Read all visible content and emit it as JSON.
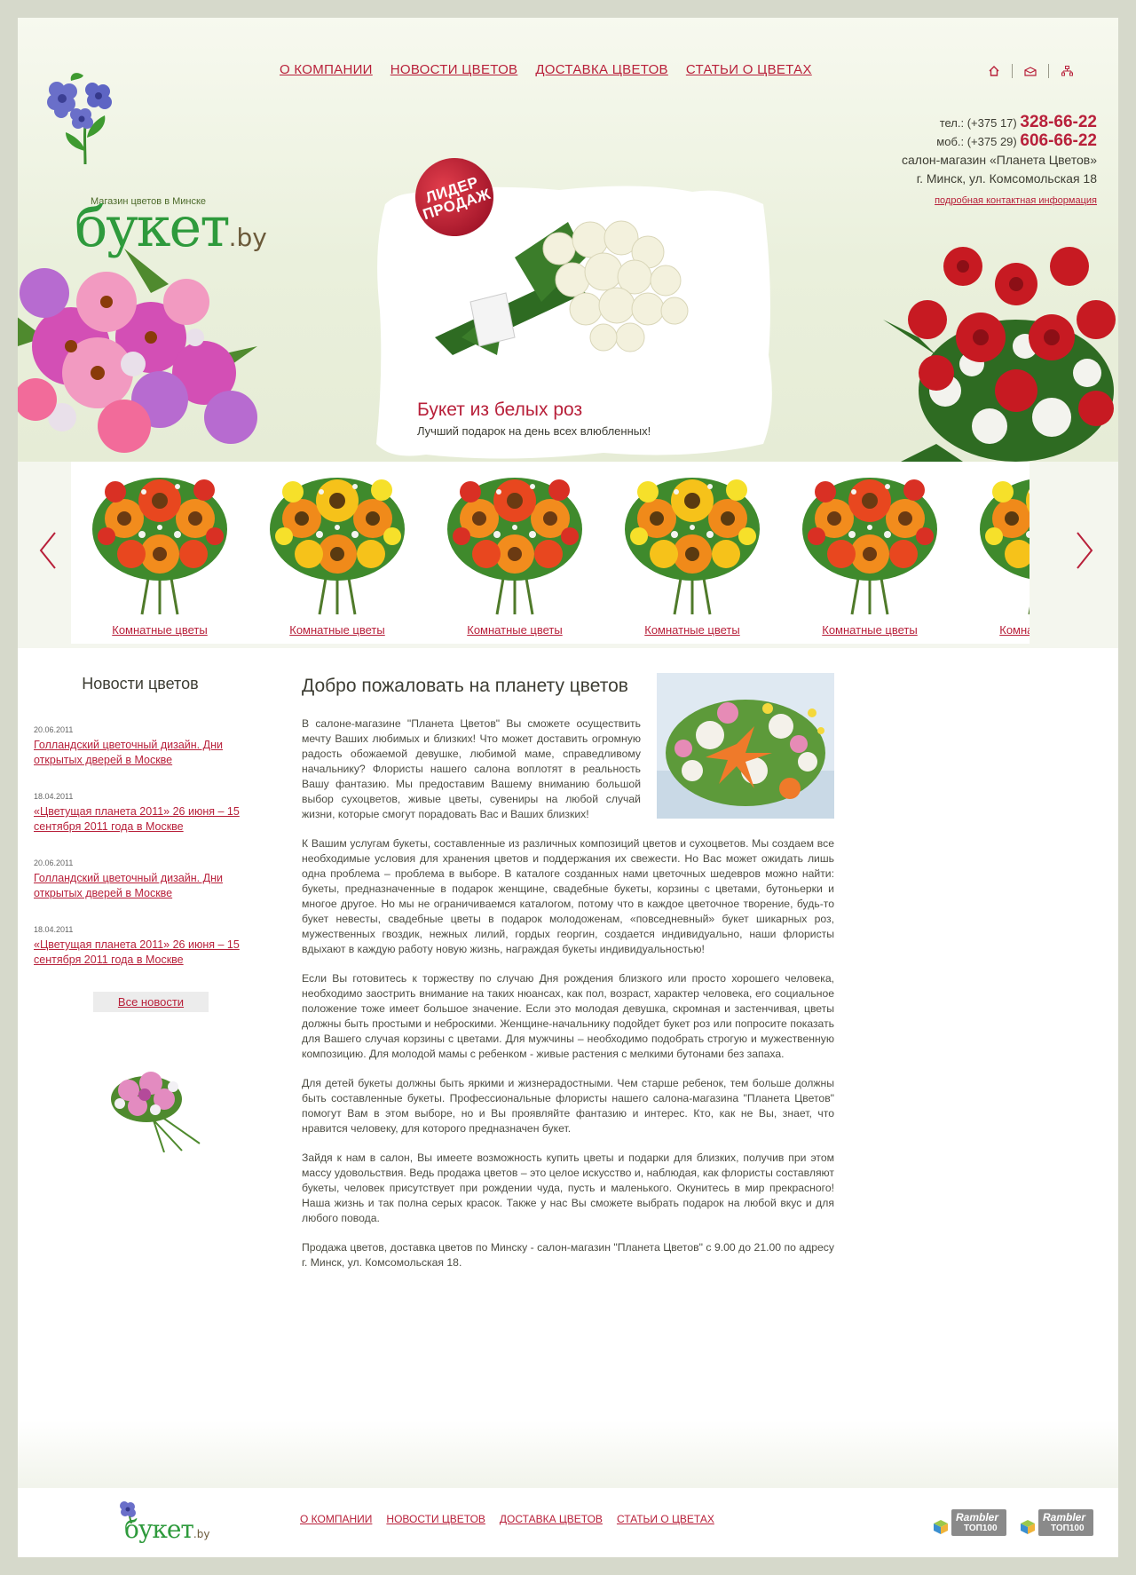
{
  "header": {
    "logo_tagline": "Магазин цветов в Минске",
    "logo_main": "букет",
    "logo_suffix": ".by",
    "nav": [
      "О КОМПАНИИ",
      "НОВОСТИ ЦВЕТОВ",
      "ДОСТАВКА ЦВЕТОВ",
      "СТАТЬИ О ЦВЕТАХ"
    ],
    "icons": [
      "home-icon",
      "mail-icon",
      "sitemap-icon"
    ],
    "contacts": {
      "tel_label": "тел.: (+375 17)",
      "tel_number": "328-66-22",
      "mob_label": "моб.: (+375 29)",
      "mob_number": "606-66-22",
      "salon": "салон-магазин «Планета Цветов»",
      "address": "г. Минск, ул. Комсомольская 18",
      "details_link": "подробная контактная информация"
    }
  },
  "promo": {
    "badge_line1": "ЛИДЕР",
    "badge_line2": "ПРОДАЖ",
    "title": "Букет из белых роз",
    "subtitle": "Лучший подарок на день всех влюбленных!"
  },
  "carousel": {
    "items": [
      {
        "caption": "Комнатные цветы"
      },
      {
        "caption": "Комнатные цветы"
      },
      {
        "caption": "Комнатные цветы"
      },
      {
        "caption": "Комнатные цветы"
      },
      {
        "caption": "Комнатные цветы"
      },
      {
        "caption": "Комнатные цветы"
      }
    ]
  },
  "sidebar": {
    "title": "Новости цветов",
    "news": [
      {
        "date": "20.06.2011",
        "title": "Голландский цветочный дизайн. Дни открытых дверей в Москве"
      },
      {
        "date": "18.04.2011",
        "title": "«Цветущая планета 2011» 26 июня – 15 сентября 2011 года в Москве"
      },
      {
        "date": "20.06.2011",
        "title": "Голландский цветочный дизайн. Дни открытых дверей в Москве"
      },
      {
        "date": "18.04.2011",
        "title": "«Цветущая планета 2011» 26 июня – 15 сентября 2011 года в Москве"
      }
    ],
    "all_news": "Все новости"
  },
  "main": {
    "title": "Добро пожаловать на планету цветов",
    "paragraphs": [
      "В салоне-магазине \"Планета Цветов\" Вы сможете осуществить мечту Ваших любимых и близких! Что может доставить огромную радость обожаемой девушке, любимой маме, справедливому начальнику? Флористы нашего салона воплотят в реальность Вашу фантазию. Мы предоставим Вашему вниманию большой выбор сухоцветов, живые цветы, сувениры на любой случай жизни, которые смогут порадовать Вас и Ваших близких!",
      "К Вашим услугам букеты, составленные из различных композиций цветов и сухоцветов. Мы создаем все необходимые условия для хранения цветов и поддержания их свежести. Но Вас может ожидать лишь одна проблема – проблема в выборе. В каталоге созданных нами цветочных шедевров можно найти: букеты, предназначенные в подарок женщине, свадебные букеты, корзины с цветами, бутоньерки и многое другое. Но мы не ограничиваемся каталогом, потому что в каждое цветочное творение, будь-то букет невесты, свадебные цветы в подарок молодоженам, «повседневный» букет шикарных роз, мужественных гвоздик, нежных лилий, гордых георгин, создается индивидуально, наши флористы вдыхают в каждую работу новую жизнь, награждая букеты индивидуальностью!",
      "Если Вы готовитесь к торжеству по случаю Дня рождения близкого или просто хорошего человека, необходимо заострить внимание на таких нюансах, как пол, возраст, характер человека, его социальное положение тоже имеет большое значение. Если это молодая девушка, скромная и застенчивая, цветы должны быть простыми и неброскими. Женщине-начальнику подойдет букет роз или попросите показать для Вашего случая корзины с цветами. Для мужчины – необходимо подобрать строгую и мужественную композицию. Для молодой мамы с ребенком - живые растения с мелкими бутонами без запаха.",
      "Для детей букеты должны быть яркими и жизнерадостными. Чем старше ребенок, тем больше должны быть составленные букеты. Профессиональные флористы нашего салона-магазина \"Планета Цветов\" помогут Вам в этом выборе, но и Вы проявляйте фантазию и интерес. Кто, как не Вы, знает, что нравится человеку, для которого предназначен букет.",
      "Зайдя к нам в салон, Вы имеете возможность купить цветы и подарки для близких, получив при этом массу удовольствия. Ведь продажа цветов – это целое искусство и, наблюдая, как флористы составляют букеты, человек присутствует при рождении чуда, пусть и маленького. Окунитесь в мир прекрасного! Наша жизнь и так полна серых красок. Также у нас Вы сможете выбрать подарок на любой вкус и для любого повода.",
      "Продажа цветов, доставка цветов по Минску - салон-магазин \"Планета Цветов\" с 9.00 до 21.00 по адресу г. Минск, ул. Комсомольская 18."
    ]
  },
  "footer": {
    "logo_main": "букет",
    "logo_suffix": ".by",
    "nav": [
      "О КОМПАНИИ",
      "НОВОСТИ ЦВЕТОВ",
      "ДОСТАВКА ЦВЕТОВ",
      "СТАТЬИ О ЦВЕТАХ"
    ],
    "counters": [
      {
        "name": "Rambler",
        "label": "ТОП100"
      },
      {
        "name": "Rambler",
        "label": "ТОП100"
      }
    ]
  },
  "colors": {
    "accent": "#b8203a",
    "logo_green": "#2e9a3c",
    "outer_bg": "#d6d9cb",
    "header_bg": "#eaf0dc"
  }
}
